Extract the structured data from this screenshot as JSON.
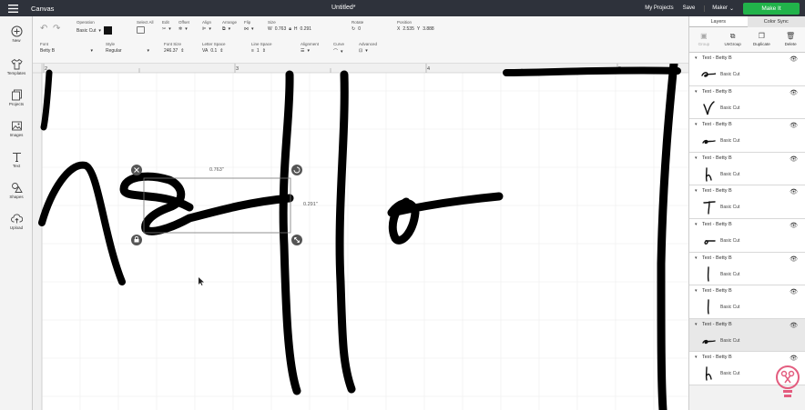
{
  "app": {
    "title": "Canvas",
    "document_title": "Untitled*",
    "nav": {
      "my_projects": "My Projects",
      "save": "Save",
      "machine": "Maker",
      "make_it": "Make It"
    }
  },
  "toolbar": {
    "operation": {
      "label": "Operation",
      "value": "Basic Cut"
    },
    "select_all": {
      "label": "Select All"
    },
    "edit": {
      "label": "Edit"
    },
    "offset": {
      "label": "Offset"
    },
    "align": {
      "label": "Align"
    },
    "arrange": {
      "label": "Arrange"
    },
    "flip": {
      "label": "Flip"
    },
    "size": {
      "label": "Size",
      "w_label": "W",
      "w_value": "0.763",
      "h_label": "H",
      "h_value": "0.291"
    },
    "rotate": {
      "label": "Rotate",
      "value": "0"
    },
    "position": {
      "label": "Position",
      "x_label": "X",
      "x_value": "2.535",
      "y_label": "Y",
      "y_value": "3.888"
    },
    "font": {
      "label": "Font",
      "value": "Betty B"
    },
    "style": {
      "label": "Style",
      "value": "Regular"
    },
    "font_size": {
      "label": "Font Size",
      "value": "246.37"
    },
    "letter_space": {
      "label": "Letter Space",
      "value": "0.1"
    },
    "line_space": {
      "label": "Line Space",
      "value": "1"
    },
    "alignment": {
      "label": "Alignment"
    },
    "curve": {
      "label": "Curve"
    },
    "advanced": {
      "label": "Advanced"
    }
  },
  "left_rail": [
    {
      "label": "New",
      "icon": "plus-circle-icon"
    },
    {
      "label": "Templates",
      "icon": "shirt-icon"
    },
    {
      "label": "Projects",
      "icon": "projects-icon"
    },
    {
      "label": "Images",
      "icon": "image-icon"
    },
    {
      "label": "Text",
      "icon": "text-icon"
    },
    {
      "label": "Shapes",
      "icon": "shapes-icon"
    },
    {
      "label": "Upload",
      "icon": "upload-icon"
    }
  ],
  "layers_panel": {
    "tabs": [
      "Layers",
      "Color Sync"
    ],
    "actions": [
      {
        "label": "Group",
        "enabled": false
      },
      {
        "label": "UnGroup",
        "enabled": true
      },
      {
        "label": "Duplicate",
        "enabled": true
      },
      {
        "label": "Delete",
        "enabled": true
      }
    ],
    "items": [
      {
        "name": "Text - Betty B",
        "type": "Basic Cut",
        "glyph": "e-wide"
      },
      {
        "name": "Text - Betty B",
        "type": "Basic Cut",
        "glyph": "v"
      },
      {
        "name": "Text - Betty B",
        "type": "Basic Cut",
        "glyph": "e"
      },
      {
        "name": "Text - Betty B",
        "type": "Basic Cut",
        "glyph": "h"
      },
      {
        "name": "Text - Betty B",
        "type": "Basic Cut",
        "glyph": "t"
      },
      {
        "name": "Text - Betty B",
        "type": "Basic Cut",
        "glyph": "o"
      },
      {
        "name": "Text - Betty B",
        "type": "Basic Cut",
        "glyph": "l"
      },
      {
        "name": "Text - Betty B",
        "type": "Basic Cut",
        "glyph": "l"
      },
      {
        "name": "Text - Betty B",
        "type": "Basic Cut",
        "glyph": "e",
        "selected": true
      },
      {
        "name": "Text - Betty B",
        "type": "Basic Cut",
        "glyph": "h"
      }
    ]
  },
  "canvas": {
    "ruler_numbers": [
      "2",
      "3",
      "4",
      "5"
    ],
    "selection": {
      "width_label": "0.763\"",
      "height_label": "0.291\""
    }
  }
}
